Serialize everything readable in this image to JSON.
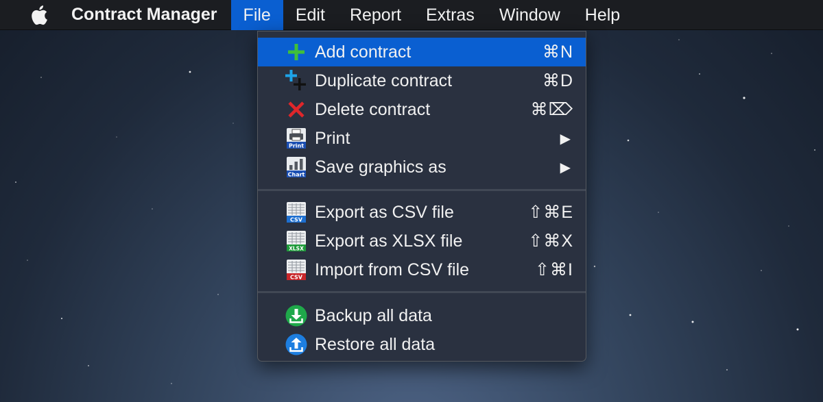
{
  "menubar": {
    "app_name": "Contract Manager",
    "menus": [
      "File",
      "Edit",
      "Report",
      "Extras",
      "Window",
      "Help"
    ],
    "active_menu": "File"
  },
  "file_menu": {
    "group1": [
      {
        "label": "Add contract",
        "shortcut": "⌘N",
        "icon": "add-icon",
        "highlighted": true
      },
      {
        "label": "Duplicate contract",
        "shortcut": "⌘D",
        "icon": "duplicate-icon"
      },
      {
        "label": "Delete contract",
        "shortcut": "⌘⌦",
        "icon": "delete-icon"
      },
      {
        "label": "Print",
        "submenu": true,
        "icon": "print-icon",
        "icon_text": "Print"
      },
      {
        "label": "Save graphics as",
        "submenu": true,
        "icon": "chart-icon",
        "icon_text": "Chart"
      }
    ],
    "group2": [
      {
        "label": "Export as CSV file",
        "shortcut": "⇧⌘E",
        "icon": "csv-export-icon",
        "icon_text": "CSV"
      },
      {
        "label": "Export as XLSX file",
        "shortcut": "⇧⌘X",
        "icon": "xlsx-export-icon",
        "icon_text": "XLSX"
      },
      {
        "label": "Import from CSV file",
        "shortcut": "⇧⌘I",
        "icon": "csv-import-icon",
        "icon_text": "CSV"
      }
    ],
    "group3": [
      {
        "label": "Backup all data",
        "icon": "backup-icon"
      },
      {
        "label": "Restore all data",
        "icon": "restore-icon"
      }
    ]
  },
  "colors": {
    "highlight": "#0a5fd1",
    "menu_bg": "#2a3140",
    "add_green": "#3fbf3a",
    "delete_red": "#e0262a",
    "csv_blue": "#1d6fd0",
    "xlsx_green": "#1e9a3a",
    "import_red": "#c8262a",
    "backup_green": "#1fa84a",
    "restore_blue": "#1d7ee0"
  }
}
